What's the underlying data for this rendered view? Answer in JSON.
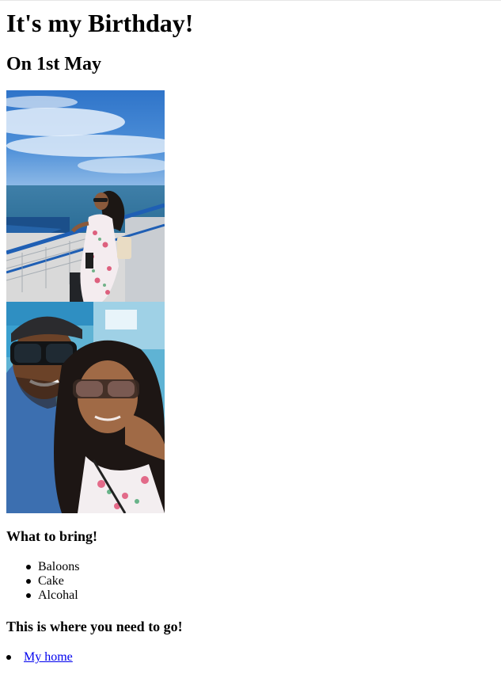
{
  "heading": "It's my Birthday!",
  "date": "On 1st May",
  "photos": [
    {
      "name": "harbor-photo",
      "alt": "Woman standing at ferry railing by the sea"
    },
    {
      "name": "selfie-photo",
      "alt": "Couple selfie wearing sunglasses"
    }
  ],
  "bring": {
    "title": "What to bring!",
    "items": [
      "Baloons",
      "Cake",
      "Alcohal"
    ]
  },
  "location": {
    "title": "This is where you need to go!",
    "link_label": "My home"
  }
}
